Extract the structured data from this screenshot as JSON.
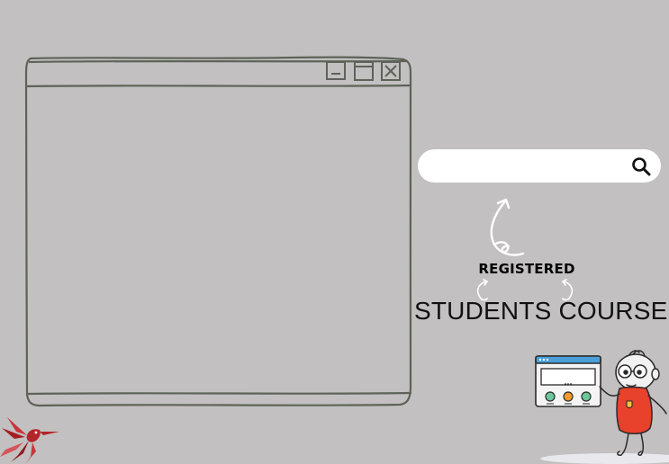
{
  "window": {
    "controls": [
      "minimize",
      "maximize",
      "close"
    ]
  },
  "search": {
    "value": "",
    "placeholder": ""
  },
  "labels": {
    "registered": "REGISTERED",
    "course": "STUDENTS COURSE"
  },
  "colors": {
    "background": "#c2c0c0",
    "sketch_stroke": "#5e6359",
    "search_bg": "#ffffff",
    "bird_red": "#b5242a",
    "character_red": "#e8412c",
    "screen_blue": "#4a9fd8",
    "button_green": "#6cc79a",
    "button_orange": "#f29a2e"
  },
  "icons": [
    "minimize-icon",
    "maximize-icon",
    "close-icon",
    "search-icon",
    "curly-arrow-icon",
    "hummingbird-logo",
    "character-illustration"
  ]
}
